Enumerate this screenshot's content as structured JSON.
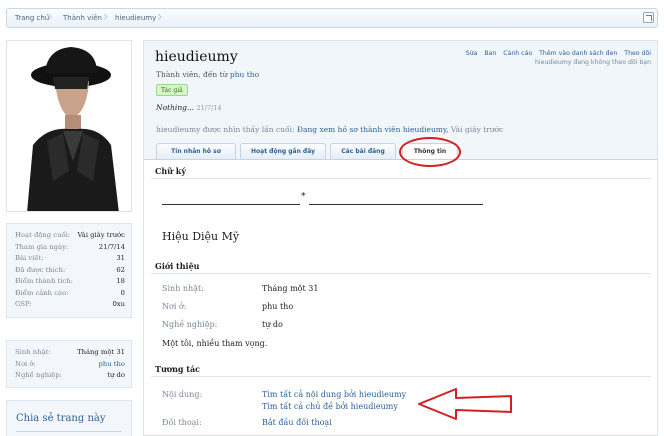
{
  "breadcrumb": {
    "items": [
      "Trang chủ",
      "Thành viên",
      "hieudieumy"
    ]
  },
  "sidebar": {
    "stats": [
      {
        "label": "Hoạt động cuối:",
        "value": "Vài giây trước"
      },
      {
        "label": "Tham gia ngày:",
        "value": "21/7/14"
      },
      {
        "label": "Bài viết:",
        "value": "31"
      },
      {
        "label": "Đã được thích:",
        "value": "62"
      },
      {
        "label": "Điểm thành tích:",
        "value": "18"
      },
      {
        "label": "Điểm cảnh cáo:",
        "value": "0"
      },
      {
        "label": "GSP:",
        "value": "0xu"
      }
    ],
    "info": [
      {
        "label": "Sinh nhật:",
        "value": "Tháng một 31"
      },
      {
        "label": "Nơi ở:",
        "value": "phu tho"
      },
      {
        "label": "Nghề nghiệp:",
        "value": "tự do"
      }
    ],
    "share_title": "Chia sẻ trang này"
  },
  "profile": {
    "username": "hieudieumy",
    "title_prefix": "Thành viên, đến từ",
    "location": "phu tho",
    "badge": "Tác giả",
    "status": "Nothing...",
    "status_time": "21/7/14",
    "last_seen_prefix": "hieudieumy được nhìn thấy lần cuối:",
    "last_seen_activity": "Đang xem hồ sơ thành viên hieudieumy,",
    "last_seen_ago": "Vài giây trước",
    "mod_links": [
      "Sửa",
      "Ban",
      "Cảnh cáo",
      "Thêm vào danh sách đen",
      "Theo dõi"
    ],
    "follow_note": "hieudieumy đang không theo dõi bạn"
  },
  "tabs": [
    "Tin nhắn hồ sơ",
    "Hoạt động gần đây",
    "Các bài đăng",
    "Thông tin"
  ],
  "signature": {
    "heading": "Chữ ký",
    "star": "*",
    "name": "Hiệu Diệu Mỹ"
  },
  "about": {
    "heading": "Giới thiệu",
    "rows": [
      {
        "label": "Sinh nhật:",
        "value": "Tháng một 31"
      },
      {
        "label": "Nơi ở:",
        "value": "phu tho"
      },
      {
        "label": "Nghề nghiệp:",
        "value": "tự do"
      }
    ],
    "text": "Một tôi, nhiều tham vọng."
  },
  "interact": {
    "heading": "Tương tác",
    "content_label": "Nội dung:",
    "content_link1": "Tìm tất cả nội dung bởi hieudieumy",
    "content_link2": "Tìm tất cả chủ đề bởi hieudieumy",
    "conversation_label": "Đối thoại:",
    "conversation_link": "Bắt đầu đối thoại"
  },
  "annotation_color": "#d51f1f"
}
